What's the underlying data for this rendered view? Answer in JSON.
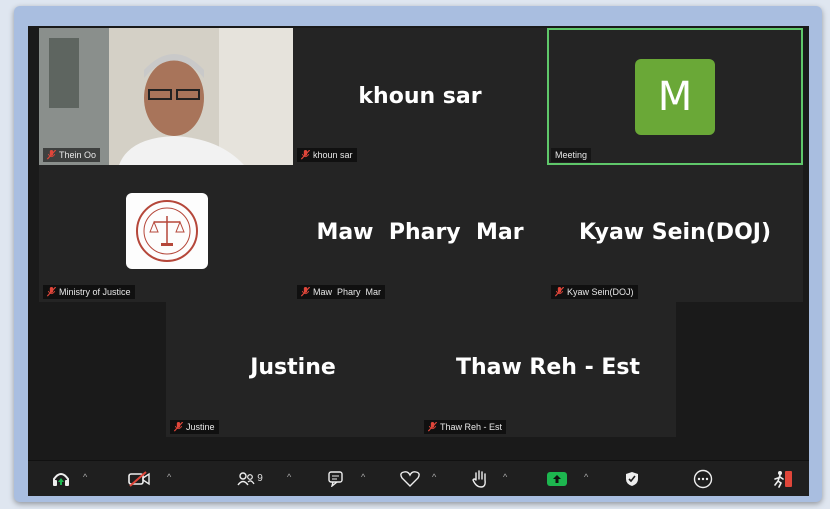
{
  "participants": {
    "thein_oo": {
      "label": "Thein Oo"
    },
    "khoun_sar": {
      "display": "khoun sar",
      "label": "khoun sar"
    },
    "meeting": {
      "initial": "M",
      "label": "Meeting"
    },
    "ministry": {
      "label": "Ministry of Justice"
    },
    "maw_phary_mar": {
      "display": "Maw  Phary  Mar",
      "label": "Maw  Phary  Mar"
    },
    "kyaw_sein": {
      "display": "Kyaw Sein(DOJ)",
      "label": "Kyaw Sein(DOJ)"
    },
    "justine": {
      "display": "Justine",
      "label": "Justine"
    },
    "thaw_reh": {
      "display": "Thaw Reh - Est",
      "label": "Thaw Reh - Est"
    }
  },
  "toolbar": {
    "participants_count": "9"
  },
  "colors": {
    "active_speaker": "#5fc76a",
    "avatar_bg": "#6aa837",
    "muted_mic": "#e0463a",
    "share_green": "#1db64f",
    "leave_red": "#e0463a"
  },
  "icons": [
    "headphones-icon",
    "video-off-icon",
    "participants-icon",
    "chat-icon",
    "reactions-icon",
    "raise-hand-icon",
    "share-screen-icon",
    "security-icon",
    "more-icon",
    "leave-icon",
    "mic-muted-icon"
  ]
}
